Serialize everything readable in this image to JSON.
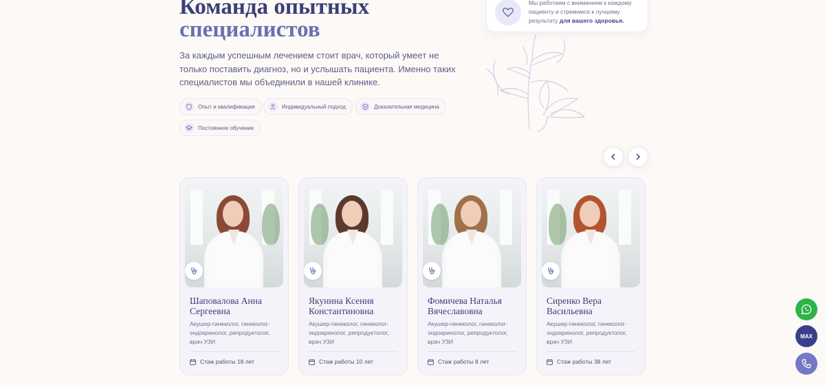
{
  "heading": {
    "line1": "Команда опытных",
    "line2": "специалистов"
  },
  "lead": "За каждым успешным лечением стоит врач, который умеет не только поставить диагноз, но и услышать пациента. Именно таких специалистов мы объединили в нашей клинике.",
  "features": [
    {
      "label": "Опыт и квалификация",
      "icon": "shield-icon"
    },
    {
      "label": "Индивидуальный подход",
      "icon": "person-icon"
    },
    {
      "label": "Доказательная медицина",
      "icon": "heart-shield-icon"
    },
    {
      "label": "Постоянное обучение",
      "icon": "graduation-cap-icon"
    }
  ],
  "info_card": {
    "icon": "heart-icon",
    "text": "Мы работаем с вниманием к каждому пациенту и стремимся к лучшему результату",
    "bold": "для вашего здоровья."
  },
  "carousel": {
    "prev_icon": "chevron-left-icon",
    "next_icon": "chevron-right-icon"
  },
  "doctors": [
    {
      "name": "Шаповалова Анна Сергеевна",
      "specialty": "Акушер-гинеколог, гинеколог-эндокринолог, репродуктолог, врач УЗИ",
      "experience": "Стаж работы 18 лет",
      "hair_color": "#8a4a35"
    },
    {
      "name": "Якунина Ксения Константиновна",
      "specialty": "Акушер-гинеколог, гинеколог-эндокринолог, репродуктолог, врач УЗИ",
      "experience": "Стаж работы 10 лет",
      "hair_color": "#5a3a2a"
    },
    {
      "name": "Фомичева Наталья Вячеславовна",
      "specialty": "Акушер-гинеколог, гинеколог-эндокринолог, репродуктолог, врач УЗИ",
      "experience": "Стаж работы 8 лет",
      "hair_color": "#a0704a"
    },
    {
      "name": "Сиренко Вера Васильевна",
      "specialty": "Акушер-гинеколог, гинеколог-эндокринолог, репродуктолог, врач УЗИ",
      "experience": "Стаж работы 38 лет",
      "hair_color": "#b4542e"
    }
  ],
  "floating_buttons": {
    "whatsapp": {
      "icon": "whatsapp-icon",
      "color": "#2eb34a"
    },
    "max": {
      "label": "MAX",
      "color": "#3b3f8a"
    },
    "phone": {
      "icon": "phone-icon",
      "color": "#7479c4"
    }
  }
}
